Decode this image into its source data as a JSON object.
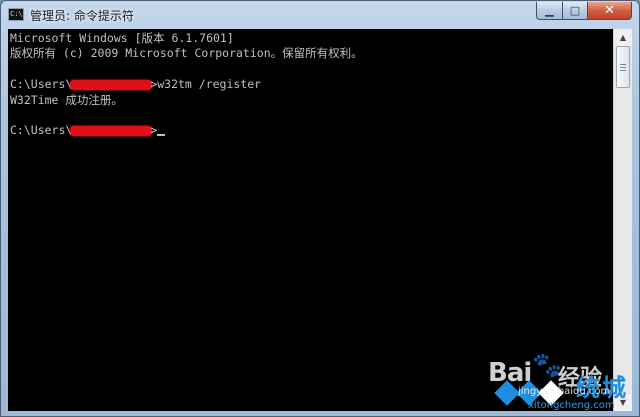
{
  "window": {
    "title": "管理员: 命令提示符",
    "icon": "console-icon",
    "icon_text": "C:\\"
  },
  "caption_buttons": {
    "minimize": "▁",
    "maximize": "□",
    "close": "✕"
  },
  "console": {
    "lines": [
      "Microsoft Windows [版本 6.1.7601]",
      "版权所有 (c) 2009 Microsoft Corporation。保留所有权利。",
      "",
      "C:\\Users\\",
      "W32Time 成功注册。",
      "",
      "C:\\Users\\"
    ],
    "command": ">w32tm /register",
    "prompt_end": ">",
    "redaction_color": "#e0101a"
  },
  "scrollbar": {
    "up_arrow": "▲",
    "down_arrow": "▼"
  },
  "watermark": {
    "logo": "Bai",
    "paw": "🐾",
    "jingyan": "经验",
    "site_text": "统城",
    "url": "jingyan.baidu.com",
    "url2": "xitongcheng.com"
  }
}
